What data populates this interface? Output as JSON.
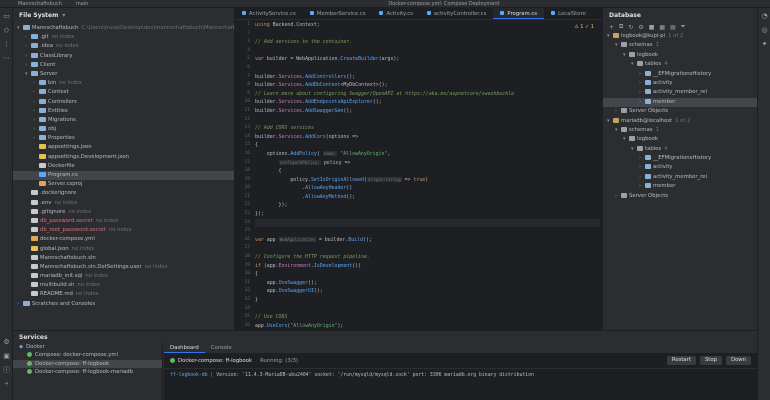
{
  "titlebar": {
    "project": "Mannschaftsbuch",
    "branch": "main",
    "run_config": "Docker-compose.yml: Compose Deployment"
  },
  "filesystem": {
    "title": "File System",
    "items": [
      {
        "level": 0,
        "arrow": "▾",
        "type": "folder",
        "label": "Mannschaftsbuch",
        "hint": "C:\\Users\\jrusa\\Desktop\\dev\\mannschaftsbuch\\Mannschaftsbuch"
      },
      {
        "level": 1,
        "arrow": "›",
        "type": "folder",
        "label": ".git",
        "hint": "no index"
      },
      {
        "level": 1,
        "arrow": "›",
        "type": "folder",
        "label": ".idea",
        "hint": "no index"
      },
      {
        "level": 1,
        "arrow": "›",
        "type": "folder",
        "label": "ClassLibrary",
        "hint": ""
      },
      {
        "level": 1,
        "arrow": "›",
        "type": "folder",
        "label": "Client",
        "hint": ""
      },
      {
        "level": 1,
        "arrow": "▾",
        "type": "folder",
        "label": "Server",
        "hint": ""
      },
      {
        "level": 2,
        "arrow": "›",
        "type": "folder",
        "label": "bin",
        "hint": "no index"
      },
      {
        "level": 2,
        "arrow": "›",
        "type": "folder",
        "label": "Context",
        "hint": ""
      },
      {
        "level": 2,
        "arrow": "›",
        "type": "folder",
        "label": "Controllers",
        "hint": ""
      },
      {
        "level": 2,
        "arrow": "›",
        "type": "folder",
        "label": "Entities",
        "hint": ""
      },
      {
        "level": 2,
        "arrow": "›",
        "type": "folder",
        "label": "Migrations",
        "hint": ""
      },
      {
        "level": 2,
        "arrow": "›",
        "type": "folder",
        "label": "obj",
        "hint": ""
      },
      {
        "level": 2,
        "arrow": "›",
        "type": "folder",
        "label": "Properties",
        "hint": ""
      },
      {
        "level": 2,
        "arrow": "",
        "type": "json",
        "label": "appsettings.json",
        "hint": ""
      },
      {
        "level": 2,
        "arrow": "",
        "type": "json",
        "label": "appsettings.Development.json",
        "hint": ""
      },
      {
        "level": 2,
        "arrow": "",
        "type": "file",
        "label": "Dockerfile",
        "hint": ""
      },
      {
        "level": 2,
        "arrow": "",
        "type": "cs",
        "label": "Program.cs",
        "hint": "",
        "selected": true
      },
      {
        "level": 2,
        "arrow": "",
        "type": "xml",
        "label": "Server.csproj",
        "hint": ""
      },
      {
        "level": 1,
        "arrow": "",
        "type": "file",
        "label": ".dockerignore",
        "hint": ""
      },
      {
        "level": 1,
        "arrow": "",
        "type": "file",
        "label": ".env",
        "hint": "no index"
      },
      {
        "level": 1,
        "arrow": "",
        "type": "file",
        "label": ".gitignore",
        "hint": "no index"
      },
      {
        "level": 1,
        "arrow": "",
        "type": "file",
        "label": "db_password.secret",
        "hint": "no index",
        "red": true
      },
      {
        "level": 1,
        "arrow": "",
        "type": "file",
        "label": "db_root_password.secret",
        "hint": "no index",
        "red": true
      },
      {
        "level": 1,
        "arrow": "",
        "type": "xml",
        "label": "docker-compose.yml",
        "hint": ""
      },
      {
        "level": 1,
        "arrow": "",
        "type": "json",
        "label": "global.json",
        "hint": "no index"
      },
      {
        "level": 1,
        "arrow": "",
        "type": "file",
        "label": "Mannschaftsbuch.sln",
        "hint": ""
      },
      {
        "level": 1,
        "arrow": "",
        "type": "file",
        "label": "Mannschaftsbuch.sln.DotSettings.user",
        "hint": "no index"
      },
      {
        "level": 1,
        "arrow": "",
        "type": "file",
        "label": "mariadb_init.sql",
        "hint": "no index"
      },
      {
        "level": 1,
        "arrow": "",
        "type": "file",
        "label": "multibuild.sh",
        "hint": "no index"
      },
      {
        "level": 1,
        "arrow": "",
        "type": "file",
        "label": "README.md",
        "hint": "no index"
      },
      {
        "level": 0,
        "arrow": "›",
        "type": "folder",
        "label": "Scratches and Consoles",
        "hint": ""
      }
    ]
  },
  "editor": {
    "tabs": [
      {
        "label": "ActivityService.cs",
        "active": false
      },
      {
        "label": "MemberService.cs",
        "active": false
      },
      {
        "label": "Activity.cs",
        "active": false
      },
      {
        "label": "activityController.cs",
        "active": false
      },
      {
        "label": "Program.cs",
        "active": true
      },
      {
        "label": "LocalStore",
        "active": false
      }
    ],
    "warnings": "⚠ 1  ✓ 1",
    "lines": [
      {
        "n": "1",
        "html": "<span class='c-kw'>using</span> Backend.Context;"
      },
      {
        "n": "2",
        "html": ""
      },
      {
        "n": "3",
        "html": "<span class='c-com'>// Add services to the container.</span>"
      },
      {
        "n": "4",
        "html": ""
      },
      {
        "n": "5",
        "html": "<span class='c-kw'>var</span> builder = <span class='c-ty'>WebApplication</span>.<span class='c-fn'>CreateBuilder</span>(args);"
      },
      {
        "n": "6",
        "html": ""
      },
      {
        "n": "7",
        "html": "builder.<span class='c-prop'>Services</span>.<span class='c-fn'>AddControllers</span>();"
      },
      {
        "n": "8",
        "html": "builder.<span class='c-prop'>Services</span>.<span class='c-fn'>AddDbContext</span>&lt;<span class='c-ty'>MyDbContext</span>&gt;();"
      },
      {
        "n": "9",
        "html": "<span class='c-com'>// Learn more about configuring Swagger/OpenAPI at https://aka.ms/aspnetcore/swashbuckle</span>"
      },
      {
        "n": "10",
        "html": "builder.<span class='c-prop'>Services</span>.<span class='c-fn'>AddEndpointsApiExplorer</span>();"
      },
      {
        "n": "11",
        "html": "builder.<span class='c-prop'>Services</span>.<span class='c-fn'>AddSwaggerGen</span>();"
      },
      {
        "n": "12",
        "html": ""
      },
      {
        "n": "13",
        "html": "<span class='c-com'>// Add CORS services</span>"
      },
      {
        "n": "14",
        "html": "builder.<span class='c-prop'>Services</span>.<span class='c-fn'>AddCors</span>(options =&gt;"
      },
      {
        "n": "15",
        "html": "{"
      },
      {
        "n": "16",
        "html": "    options.<span class='c-fn'>AddPolicy</span>( <span class='c-hint'>name:</span> <span class='c-str'>\"AllowAnyOrigin\"</span>,"
      },
      {
        "n": "17",
        "html": "        <span class='c-hint'>configurePolicy:</span> policy =&gt;"
      },
      {
        "n": "18",
        "html": "        {"
      },
      {
        "n": "19",
        "html": "            policy.<span class='c-fn'>SetIsOriginAllowed</span>(<span class='c-hint'>origin:string</span> =&gt; <span class='c-kw'>true</span>)"
      },
      {
        "n": "20",
        "html": "                .<span class='c-fn'>AllowAnyHeader</span>()"
      },
      {
        "n": "21",
        "html": "                .<span class='c-fn'>AllowAnyMethod</span>();"
      },
      {
        "n": "22",
        "html": "        });"
      },
      {
        "n": "23",
        "html": "});"
      },
      {
        "n": "24",
        "html": "",
        "cur": true
      },
      {
        "n": "25",
        "html": ""
      },
      {
        "n": "26",
        "html": "<span class='c-kw'>var</span> app <span class='c-hint'>WebApplication</span> = builder.<span class='c-fn'>Build</span>();"
      },
      {
        "n": "27",
        "html": ""
      },
      {
        "n": "28",
        "html": "<span class='c-com'>// Configure the HTTP request pipeline.</span>"
      },
      {
        "n": "29",
        "html": "<span class='c-kw'>if</span> (app.<span class='c-prop'>Environment</span>.<span class='c-fn'>IsDevelopment</span>())"
      },
      {
        "n": "30",
        "html": "{"
      },
      {
        "n": "31",
        "html": "    app.<span class='c-fn'>UseSwagger</span>();"
      },
      {
        "n": "32",
        "html": "    app.<span class='c-fn'>UseSwaggerUI</span>();"
      },
      {
        "n": "33",
        "html": "}"
      },
      {
        "n": "34",
        "html": ""
      },
      {
        "n": "35",
        "html": "<span class='c-com'>// Use CORS</span>"
      },
      {
        "n": "36",
        "html": "app.<span class='c-fn'>UseCors</span>(<span class='c-str'>\"AllowAnyOrigin\"</span>);"
      },
      {
        "n": "37",
        "html": ""
      },
      {
        "n": "38",
        "html": "app.<span class='c-fn'>UseHttpsRedirection</span>();"
      }
    ]
  },
  "database": {
    "title": "Database",
    "items": [
      {
        "level": 0,
        "arrow": "▾",
        "type": "dbicon",
        "label": "logbook@kupi-pi",
        "hint": "1 of 2"
      },
      {
        "level": 1,
        "arrow": "▾",
        "type": "schema",
        "label": "schemas",
        "hint": "1"
      },
      {
        "level": 2,
        "arrow": "▾",
        "type": "schema",
        "label": "logbook",
        "hint": ""
      },
      {
        "level": 3,
        "arrow": "▾",
        "type": "schema",
        "label": "tables",
        "hint": "4"
      },
      {
        "level": 4,
        "arrow": "›",
        "type": "tbl",
        "label": "__EFMigrationsHistory",
        "hint": ""
      },
      {
        "level": 4,
        "arrow": "›",
        "type": "tbl",
        "label": "activity",
        "hint": ""
      },
      {
        "level": 4,
        "arrow": "›",
        "type": "tbl",
        "label": "activity_member_rel",
        "hint": ""
      },
      {
        "level": 4,
        "arrow": "›",
        "type": "tbl",
        "label": "member",
        "hint": "",
        "selected": true
      },
      {
        "level": 1,
        "arrow": "›",
        "type": "schema",
        "label": "Server Objects",
        "hint": ""
      },
      {
        "level": 0,
        "arrow": "▾",
        "type": "dbicon",
        "label": "mariadb@localhost",
        "hint": "1 of 2"
      },
      {
        "level": 1,
        "arrow": "▾",
        "type": "schema",
        "label": "schemas",
        "hint": "1"
      },
      {
        "level": 2,
        "arrow": "▾",
        "type": "schema",
        "label": "logbook",
        "hint": ""
      },
      {
        "level": 3,
        "arrow": "▾",
        "type": "schema",
        "label": "tables",
        "hint": "4"
      },
      {
        "level": 4,
        "arrow": "›",
        "type": "tbl",
        "label": "__EFMigrationsHistory",
        "hint": ""
      },
      {
        "level": 4,
        "arrow": "›",
        "type": "tbl",
        "label": "activity",
        "hint": ""
      },
      {
        "level": 4,
        "arrow": "›",
        "type": "tbl",
        "label": "activity_member_rel",
        "hint": ""
      },
      {
        "level": 4,
        "arrow": "›",
        "type": "tbl",
        "label": "member",
        "hint": ""
      },
      {
        "level": 1,
        "arrow": "›",
        "type": "schema",
        "label": "Server Objects",
        "hint": ""
      }
    ]
  },
  "services": {
    "title": "Services",
    "items": [
      {
        "level": 0,
        "label": "Docker"
      },
      {
        "level": 1,
        "label": "Compose: docker-compose.yml"
      },
      {
        "level": 1,
        "label": "Docker-compose: ff-logbook",
        "selected": true
      },
      {
        "level": 1,
        "label": "Docker-compose: ff-logbook-mariadb"
      }
    ],
    "tabs": [
      "Dashboard",
      "Console"
    ],
    "active_tab": "Dashboard",
    "deployment": "Docker-compose: ff-logbook",
    "running": "Running: (3/3)",
    "buttons": {
      "restart": "Restart",
      "stop": "Stop",
      "down": "Down"
    },
    "log_prefix": "ff-logbook-db",
    "log_line": "Version: '11.4.3-MariaDB-ubu2404'  socket: '/run/mysqld/mysqld.sock'  port: 3306  mariadb.org binary distribution"
  }
}
